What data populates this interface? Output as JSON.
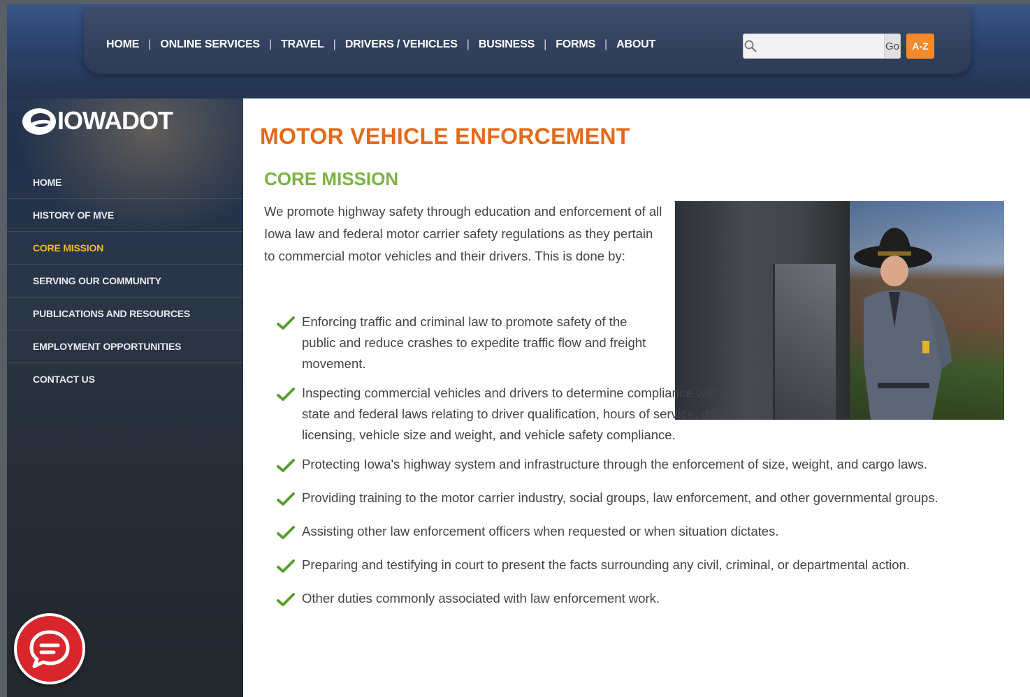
{
  "nav": {
    "items": [
      "HOME",
      "ONLINE SERVICES",
      "TRAVEL",
      "DRIVERS / VEHICLES",
      "BUSINESS",
      "FORMS",
      "ABOUT"
    ],
    "separator": "|"
  },
  "search": {
    "placeholder": "",
    "value": "",
    "go_label": "Go",
    "az_label": "A-Z",
    "icon": "search-icon"
  },
  "logo": {
    "text": "IOWADOT"
  },
  "sidebar": {
    "items": [
      {
        "label": "HOME",
        "active": false
      },
      {
        "label": "HISTORY OF MVE",
        "active": false
      },
      {
        "label": "CORE MISSION",
        "active": true
      },
      {
        "label": "SERVING OUR COMMUNITY",
        "active": false
      },
      {
        "label": "PUBLICATIONS AND RESOURCES",
        "active": false
      },
      {
        "label": "EMPLOYMENT OPPORTUNITIES",
        "active": false
      },
      {
        "label": "CONTACT US",
        "active": false
      }
    ]
  },
  "main": {
    "title": "MOTOR VEHICLE ENFORCEMENT",
    "section_title": "CORE MISSION",
    "intro": "We promote highway safety through education and enforcement of all Iowa law and federal motor carrier safety regulations as they pertain to commercial motor vehicles and their drivers. This is done by:",
    "bullets": [
      "Enforcing traffic and criminal law to promote safety of the public and reduce crashes to expedite traffic flow and freight movement.",
      "Inspecting commercial vehicles and drivers to determine compliance with state and federal laws relating to driver qualification, hours of service, driver licensing, vehicle size and weight, and vehicle safety compliance.",
      "Protecting Iowa's highway system and infrastructure through the enforcement of size, weight, and cargo laws.",
      "Providing training to the motor carrier industry, social groups, law enforcement, and other governmental groups.",
      "Assisting other law enforcement officers when requested or when situation dictates.",
      "Preparing and testifying in court to present the facts surrounding any civil, criminal, or departmental action.",
      "Other duties commonly associated with law enforcement work."
    ]
  },
  "colors": {
    "title_orange": "#e26a19",
    "section_green": "#7cb342",
    "active_nav_gold": "#f0b92f",
    "check_green": "#5a9e2f",
    "az_orange": "#f48a2a",
    "chat_red": "#d8262c"
  },
  "chat": {
    "icon": "chat-bubble-icon"
  }
}
